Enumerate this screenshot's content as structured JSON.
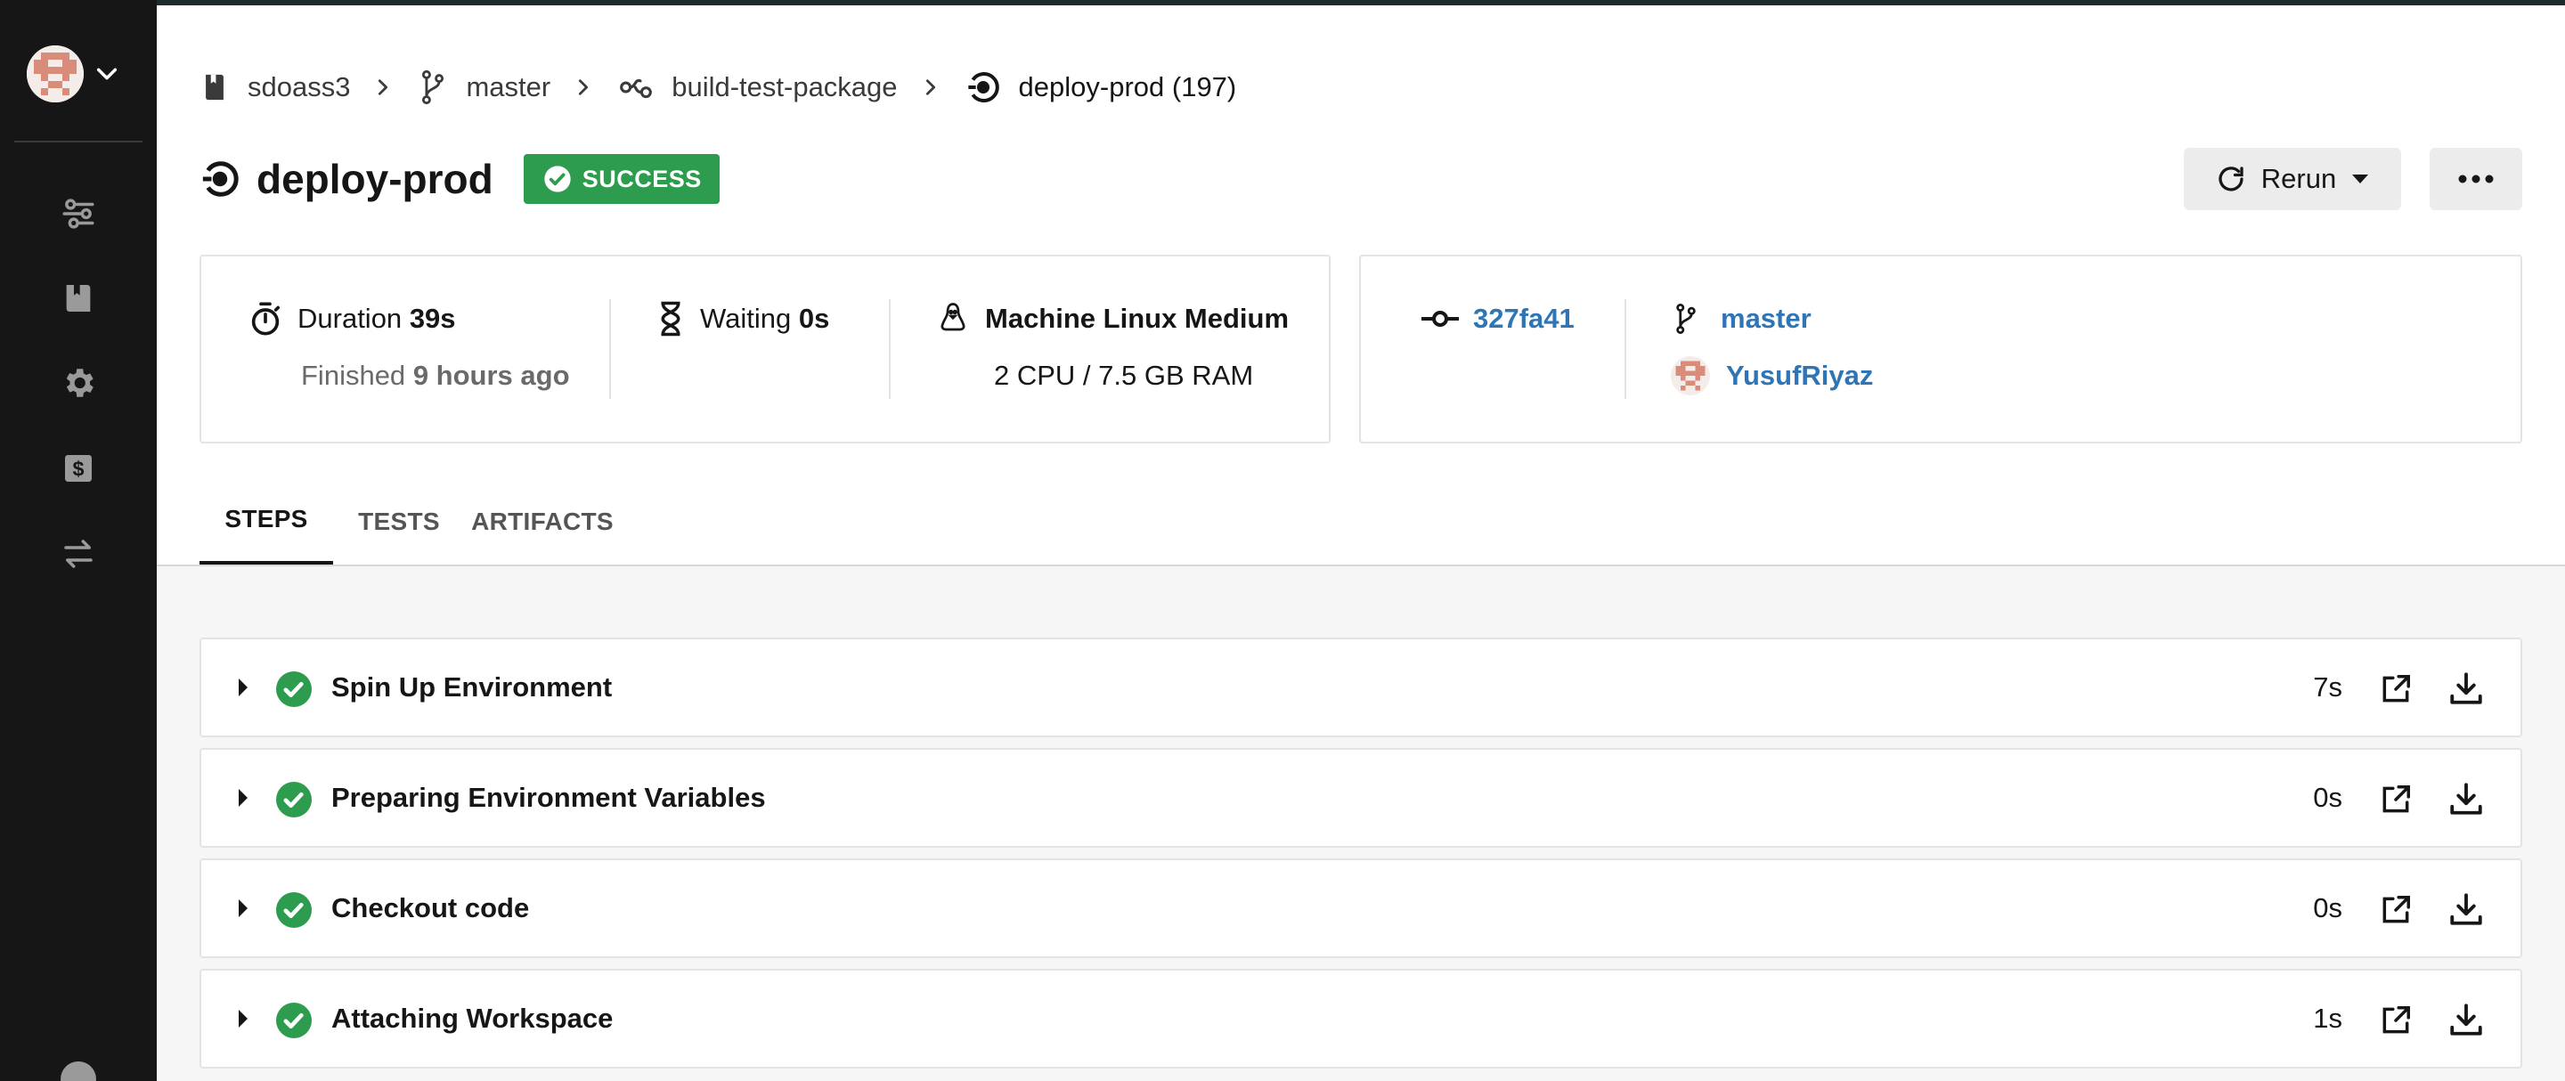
{
  "breadcrumb": {
    "project": "sdoass3",
    "branch": "master",
    "workflow": "build-test-package",
    "job": "deploy-prod (197)"
  },
  "job": {
    "title": "deploy-prod",
    "status": "SUCCESS"
  },
  "actions": {
    "rerun_label": "Rerun"
  },
  "summary": {
    "duration_label": "Duration",
    "duration_value": "39s",
    "finished_label": "Finished",
    "finished_value": "9 hours ago",
    "waiting_label": "Waiting",
    "waiting_value": "0s",
    "machine_label": "Machine Linux Medium",
    "machine_spec": "2 CPU / 7.5 GB RAM"
  },
  "vcs": {
    "commit": "327fa41",
    "branch": "master",
    "user": "YusufRiyaz"
  },
  "tabs": [
    {
      "label": "STEPS",
      "active": true
    },
    {
      "label": "TESTS",
      "active": false
    },
    {
      "label": "ARTIFACTS",
      "active": false
    }
  ],
  "steps": [
    {
      "name": "Spin Up Environment",
      "duration": "7s"
    },
    {
      "name": "Preparing Environment Variables",
      "duration": "0s"
    },
    {
      "name": "Checkout code",
      "duration": "0s"
    },
    {
      "name": "Attaching Workspace",
      "duration": "1s"
    }
  ],
  "colors": {
    "success": "#2e9c4f",
    "link": "#2f75b5",
    "sidebar": "#161616"
  },
  "icons": {
    "sidebar": [
      "pipelines-icon",
      "projects-icon",
      "settings-icon",
      "plan-dollar-icon",
      "insights-arrows-icon"
    ]
  }
}
